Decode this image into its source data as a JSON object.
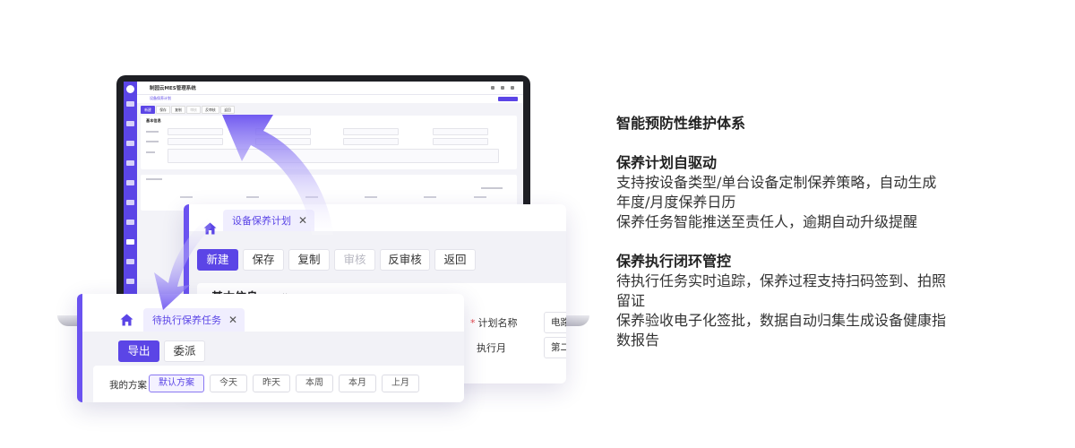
{
  "app": {
    "title": "制园云MES管理系统",
    "breadcrumb": "设备保养计划"
  },
  "plan_window": {
    "tab_label": "设备保养计划",
    "toolbar": {
      "new_label": "新建",
      "save_label": "保存",
      "copy_label": "复制",
      "audit_label": "审核",
      "unaudit_label": "反审核",
      "back_label": "返回"
    },
    "section_title": "基本信息",
    "fields": {
      "plan_name_label": "计划名称",
      "plan_name_value": "电路板",
      "exec_month_label": "执行月",
      "exec_month_value": "第二个"
    }
  },
  "task_window": {
    "tab_label": "待执行保养任务",
    "toolbar": {
      "export_label": "导出",
      "assign_label": "委派"
    },
    "scheme_label": "我的方案",
    "filters": [
      "默认方案",
      "今天",
      "昨天",
      "本周",
      "本月",
      "上月"
    ],
    "active_filter_index": 0
  },
  "content": {
    "main_title": "智能预防性维护体系",
    "section1": {
      "title": "保养计划自驱动",
      "lines": [
        "支持按设备类型/单台设备定制保养策略，自动生成",
        "年度/月度保养日历",
        "保养任务智能推送至责任人，逾期自动升级提醒"
      ]
    },
    "section2": {
      "title": "保养执行闭环管控",
      "lines": [
        "待执行任务实时追踪，保养过程支持扫码签到、拍照",
        "留证",
        "保养验收电子化签批，数据自动归集生成设备健康指",
        "数报告"
      ]
    }
  },
  "colors": {
    "accent": "#5b45e6",
    "arrow": "#7a64f2",
    "required": "#e5484d"
  }
}
